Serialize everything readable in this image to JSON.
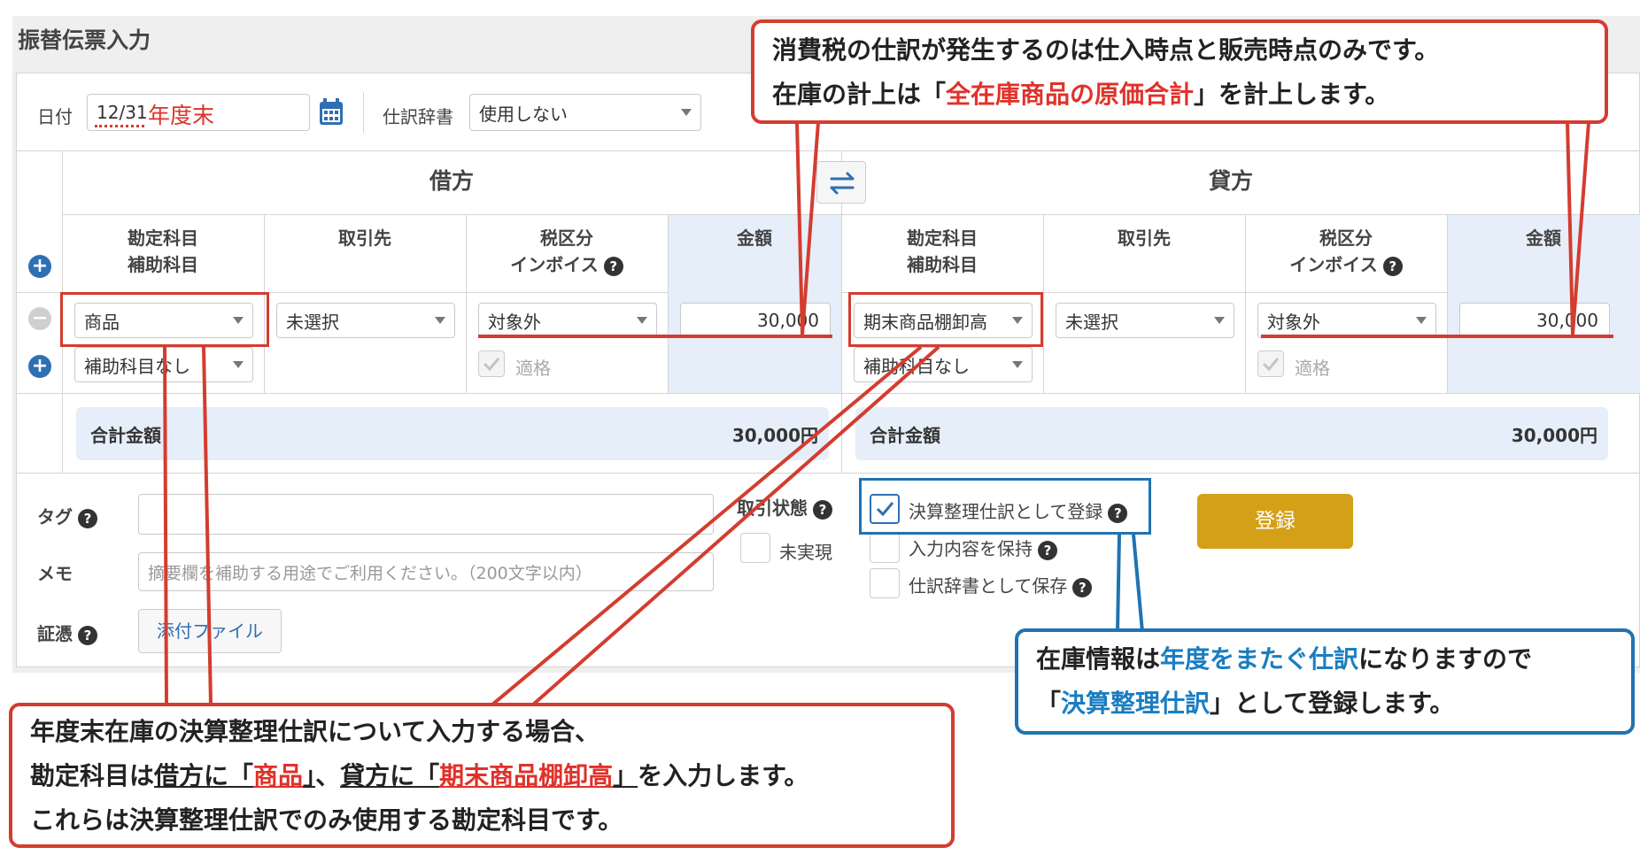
{
  "page_title": "振替伝票入力",
  "date": {
    "label": "日付",
    "value": "12/31",
    "note": "年度末"
  },
  "dictionary": {
    "label": "仕訳辞書",
    "value": "使用しない"
  },
  "debit": {
    "title": "借方",
    "headers": {
      "account": "勘定科目",
      "sub_account": "補助科目",
      "partner": "取引先",
      "tax": "税区分",
      "invoice": "インボイス",
      "amount": "金額"
    },
    "account": "商品",
    "sub_account": "補助科目なし",
    "partner": "未選択",
    "tax": "対象外",
    "compliant": "適格",
    "amount": "30,000",
    "total_label": "合計金額",
    "total": "30,000円"
  },
  "credit": {
    "title": "貸方",
    "headers": {
      "account": "勘定科目",
      "sub_account": "補助科目",
      "partner": "取引先",
      "tax": "税区分",
      "invoice": "インボイス",
      "amount": "金額"
    },
    "account": "期末商品棚卸高",
    "sub_account": "補助科目なし",
    "partner": "未選択",
    "tax": "対象外",
    "compliant": "適格",
    "amount": "30,000",
    "total_label": "合計金額",
    "total": "30,000円"
  },
  "bottom": {
    "tag_label": "タグ",
    "memo_label": "メモ",
    "memo_placeholder": "摘要欄を補助する用途でご利用ください。（200文字以内）",
    "evidence_label": "証憑",
    "attach_button": "添付ファイル",
    "status_label": "取引状態",
    "unrealized": "未実現",
    "closing_entry": "決算整理仕訳として登録",
    "keep_input": "入力内容を保持",
    "save_dictionary": "仕訳辞書として保存",
    "register_button": "登録"
  },
  "callout_top": {
    "line1": "消費税の仕訳が発生するのは仕入時点と販売時点のみです。",
    "line2_a": "在庫の計上は「",
    "line2_b": "全在庫商品の原価合計",
    "line2_c": "」を計上します。"
  },
  "callout_right": {
    "line1_a": "在庫情報は",
    "line1_b": "年度をまたぐ仕訳",
    "line1_c": "になりますので",
    "line2_a": "「",
    "line2_b": "決算整理仕訳",
    "line2_c": "」として登録します。"
  },
  "callout_bottom": {
    "line1": "年度末在庫の決算整理仕訳について入力する場合、",
    "line2_a": "勘定科目は",
    "line2_b": "借方に「",
    "line2_c": "商品",
    "line2_d": "」",
    "line2_e": "、",
    "line2_f": "貸方に「",
    "line2_g": "期末商品棚卸高",
    "line2_h": "」",
    "line2_i": "を入力します。",
    "line3": "これらは決算整理仕訳でのみ使用する勘定科目です。"
  },
  "colors": {
    "accent_red": "#d43c2f",
    "accent_blue": "#1f73b2",
    "register": "#d4a017",
    "amount_bg": "#e6eef9"
  }
}
